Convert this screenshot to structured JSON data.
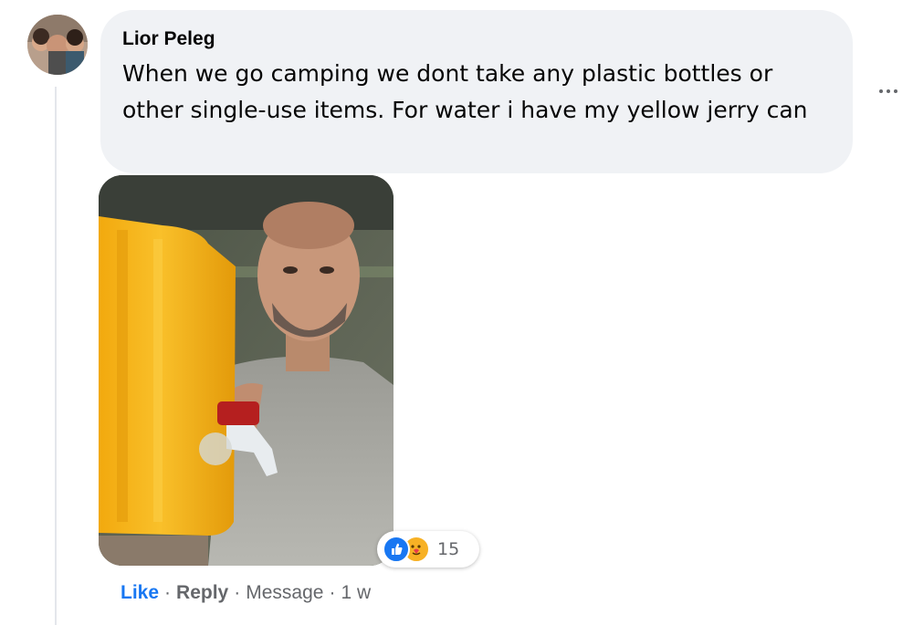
{
  "comment": {
    "author": "Lior Peleg",
    "text": "When we go camping we dont take any plastic bottles or other single-use items. For water i have my yellow jerry can",
    "attachment": "photo",
    "reactions": {
      "icons": [
        "like-icon",
        "care-icon"
      ],
      "count": "15"
    },
    "actions": {
      "like": "Like",
      "reply": "Reply",
      "message": "Message",
      "time": "1 w",
      "separator": "·"
    },
    "more_options_icon": "more-dots-icon"
  },
  "colors": {
    "like_blue": "#1877f2",
    "bubble_bg": "#f0f2f5",
    "secondary_text": "#65676b",
    "jerry_can_yellow": "#f5b419"
  }
}
